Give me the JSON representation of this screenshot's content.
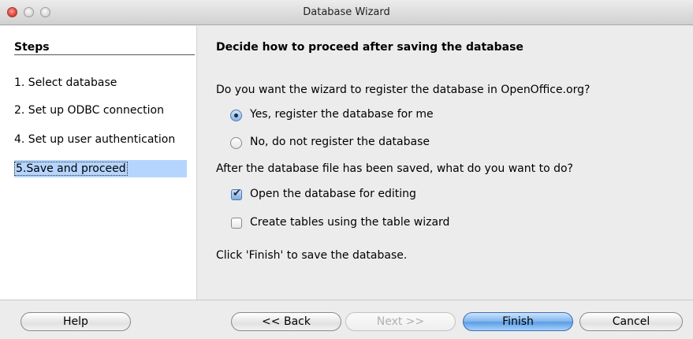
{
  "window": {
    "title": "Database Wizard"
  },
  "steps": {
    "header": "Steps",
    "items": [
      {
        "label": "1. Select database",
        "active": false
      },
      {
        "label": "2. Set up ODBC connection",
        "active": false
      },
      {
        "label": "4. Set up user authentication",
        "active": false
      },
      {
        "label": "5.Save and proceed",
        "active": true
      }
    ]
  },
  "main": {
    "heading": "Decide how to proceed after saving the database",
    "register_question": "Do you want the wizard to register the database in OpenOffice.org?",
    "radio_yes": "Yes, register the database for me",
    "radio_no": "No, do not register the database",
    "selected_radio": "yes",
    "after_question": "After the database file has been saved, what do you want to do?",
    "check_open": "Open the database for editing",
    "check_open_checked": true,
    "check_tables": "Create tables using the table wizard",
    "check_tables_checked": false,
    "finish_hint": "Click 'Finish' to save the database."
  },
  "buttons": {
    "help": "Help",
    "back": "<< Back",
    "next": "Next >>",
    "finish": "Finish",
    "cancel": "Cancel"
  }
}
